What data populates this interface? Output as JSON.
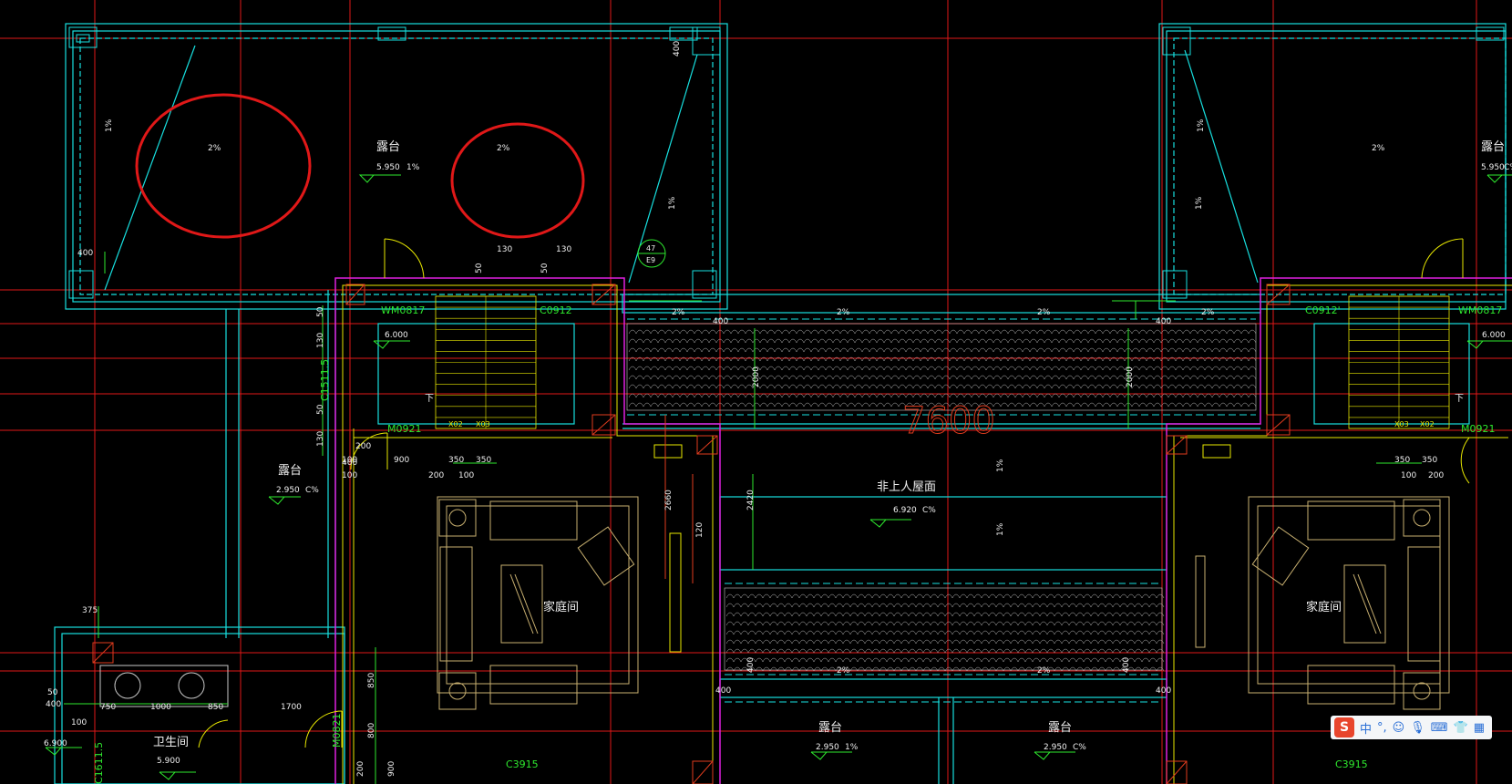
{
  "drawing": {
    "colors": {
      "background": "#000000",
      "axis": "#e01818",
      "wall": "#17e0e0",
      "dim": "#2ee82e",
      "magenta": "#e020e0",
      "yellow": "#e8e800",
      "furniture": "#c8b070",
      "text": "#f0f0f0",
      "annot": "#e03c1e",
      "circle": "#e01818"
    },
    "rooms": [
      {
        "name": "露台",
        "elev": "5.950",
        "note": "1%"
      },
      {
        "name": "露台",
        "elev": "2.950",
        "note": "C%"
      },
      {
        "name": "非上人屋面",
        "elev": "6.920",
        "note": "C%"
      },
      {
        "name": "家庭间"
      },
      {
        "name": "家庭间"
      },
      {
        "name": "露台",
        "elev": "2.950",
        "note": "1%"
      },
      {
        "name": "露台",
        "elev": "2.950",
        "note": "C%"
      },
      {
        "name": "卫生间",
        "elev": "5.900"
      },
      {
        "name": "露台",
        "elev": "5.950",
        "note": "C%"
      }
    ],
    "slope_labels": [
      "2%",
      "2%",
      "1%",
      "1%",
      "2%",
      "2%",
      "2%",
      "2%",
      "1%",
      "1%",
      "2%",
      "2%",
      "1%",
      "1%",
      "2%"
    ],
    "window_labels": [
      "WM0817",
      "C0912",
      "M0921",
      "C0912'",
      "WM0817",
      "M0921",
      "C3915",
      "C3915",
      "C1511.5",
      "M0821",
      "C1611.5"
    ],
    "elev_marks": [
      "6.000",
      "6.000",
      "6.900"
    ],
    "dim_labels": [
      "400",
      "400",
      "400",
      "400",
      "130",
      "50",
      "130",
      "50",
      "50",
      "130",
      "50",
      "130",
      "200",
      "100",
      "900",
      "350",
      "350",
      "200",
      "100",
      "100",
      "400",
      "350",
      "350",
      "100",
      "200",
      "2000",
      "2000",
      "400",
      "400",
      "2660",
      "2420",
      "120",
      "400",
      "400",
      "375",
      "50",
      "400",
      "100",
      "750",
      "1000",
      "850",
      "1700",
      "850",
      "800",
      "200",
      "900"
    ],
    "big_dim": "7600",
    "detail_ref": {
      "top": "47",
      "bottom": "E9"
    },
    "stair_down": [
      "下",
      "下"
    ],
    "stair_tags": [
      "X02",
      "X03",
      "X03",
      "X02"
    ]
  },
  "ime_bar": {
    "logo": "S",
    "mode": "中",
    "punct": "°,",
    "emoji_icon": "smile-icon",
    "mic_icon": "mic-icon",
    "keyboard_icon": "keyboard-icon",
    "skin_icon": "shirt-icon",
    "toolbox_icon": "grid-icon"
  }
}
